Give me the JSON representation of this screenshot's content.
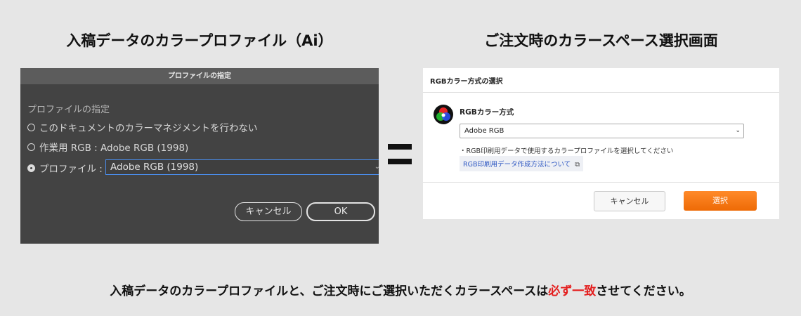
{
  "headings": {
    "left": "入稿データのカラープロファイル（Ai）",
    "right": "ご注文時のカラースペース選択画面"
  },
  "illustrator_dialog": {
    "title": "プロファイルの指定",
    "section_label": "プロファイルの指定",
    "options": [
      {
        "label": "このドキュメントのカラーマネジメントを行わない",
        "selected": false
      },
      {
        "label": "作業用 RGB : Adobe RGB (1998)",
        "selected": false
      },
      {
        "label": "プロファイル :",
        "selected": true
      }
    ],
    "profile_value": "Adobe RGB (1998)",
    "cancel_label": "キャンセル",
    "ok_label": "OK"
  },
  "order_dialog": {
    "title": "RGBカラー方式の選択",
    "section_title": "RGBカラー方式",
    "select_value": "Adobe RGB",
    "note": "・RGB印刷用データで使用するカラープロファイルを選択してください",
    "link_text": "RGB印刷用データ作成方法について",
    "cancel_label": "キャンセル",
    "select_label": "選択"
  },
  "footer": {
    "before": "入稿データのカラープロファイルと、ご注文時にご選択いただくカラースペースは",
    "emphasis": "必ず一致",
    "after": "させてください。"
  },
  "colors": {
    "emphasis": "#e41d1d",
    "select_button": "#ee6a05",
    "focus_border": "#4a8be8"
  }
}
